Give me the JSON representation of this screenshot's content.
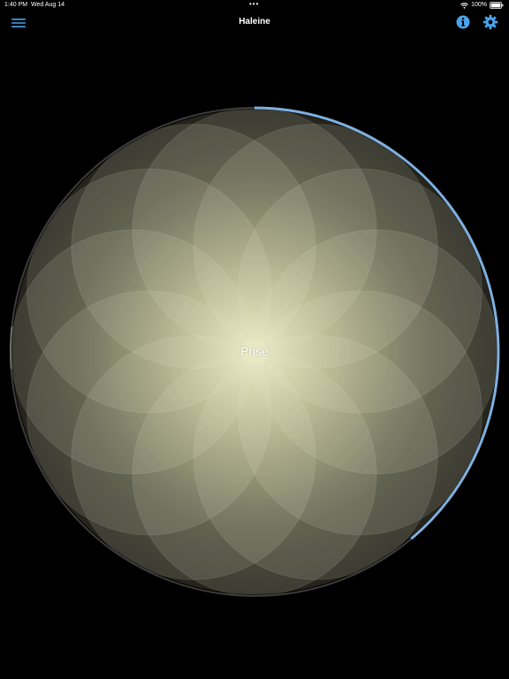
{
  "status_bar": {
    "time": "1:40 PM",
    "date": "Wed Aug 14",
    "battery": "100%",
    "icons": [
      "wifi-icon",
      "battery-icon"
    ]
  },
  "nav": {
    "title": "Haleine",
    "left_icon": "hamburger-menu-icon",
    "right_icons": [
      "info-icon",
      "gear-icon"
    ]
  },
  "breath": {
    "phase": "Prise"
  },
  "colors": {
    "accent": "#4aa3ea",
    "progress": "#7fb0e0",
    "glow": "#f4f4b4"
  }
}
